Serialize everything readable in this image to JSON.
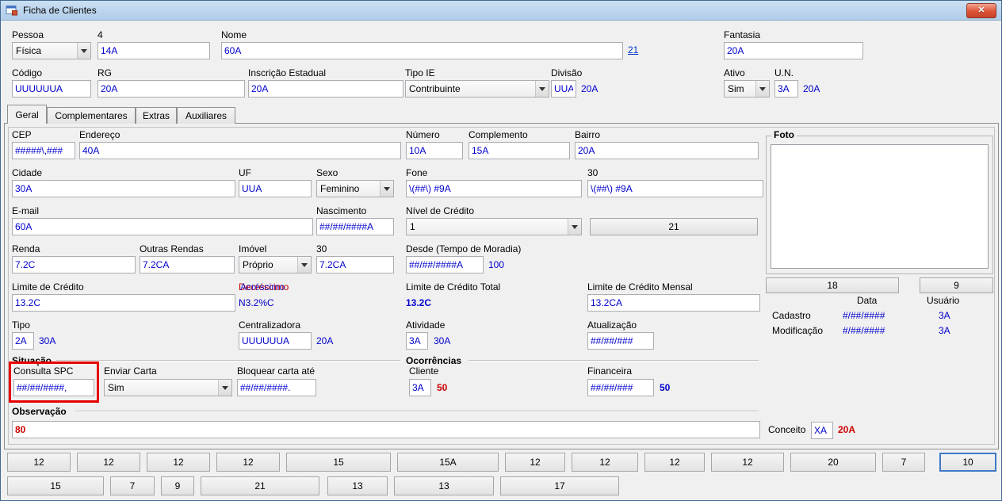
{
  "window": {
    "title": "Ficha de Clientes"
  },
  "header": {
    "pessoa": {
      "label": "Pessoa",
      "value": "Física"
    },
    "seq": {
      "label": "4",
      "value": "14A"
    },
    "nome": {
      "label": "Nome",
      "value": "60A",
      "link": "21"
    },
    "fantasia": {
      "label": "Fantasia",
      "value": "20A"
    },
    "codigo": {
      "label": "Código",
      "value": "UUUUUUA"
    },
    "rg": {
      "label": "RG",
      "value": "20A"
    },
    "inscricao_estadual": {
      "label": "Inscrição Estadual",
      "value": "20A"
    },
    "tipo_ie": {
      "label": "Tipo IE",
      "value": "Contribuinte"
    },
    "divisao": {
      "label": "Divisão",
      "value": "UUA",
      "extra": "20A"
    },
    "ativo": {
      "label": "Ativo",
      "value": "Sim"
    },
    "un": {
      "label": "U.N.",
      "value": "3A",
      "extra": "20A"
    }
  },
  "tabs": {
    "geral": "Geral",
    "complementares": "Complementares",
    "extras": "Extras",
    "auxiliares": "Auxiliares"
  },
  "geral": {
    "cep": {
      "label": "CEP",
      "value": "#####\\,###"
    },
    "endereco": {
      "label": "Endereço",
      "value": "40A"
    },
    "numero": {
      "label": "Número",
      "value": "10A"
    },
    "complemento": {
      "label": "Complemento",
      "value": "15A"
    },
    "bairro": {
      "label": "Bairro",
      "value": "20A"
    },
    "cidade": {
      "label": "Cidade",
      "value": "30A"
    },
    "uf": {
      "label": "UF",
      "value": "UUA"
    },
    "sexo": {
      "label": "Sexo",
      "value": "Feminino"
    },
    "fone": {
      "label": "Fone",
      "value": "\\(##\\) #9A"
    },
    "fone2": {
      "label": "30",
      "value": "\\(##\\) #9A"
    },
    "email": {
      "label": "E-mail",
      "value": "60A"
    },
    "nascimento": {
      "label": "Nascimento",
      "value": "##/##/####A"
    },
    "nivel_credito": {
      "label": "Nível de Crédito",
      "value": "1",
      "button": "21"
    },
    "renda": {
      "label": "Renda",
      "value": "7.2C"
    },
    "outras_rendas": {
      "label": "Outras Rendas",
      "value": "7.2CA"
    },
    "imovel": {
      "label": "Imóvel",
      "value": "Próprio"
    },
    "imovel_valor": {
      "label": "30",
      "value": "7.2CA"
    },
    "desde": {
      "label": "Desde (Tempo de Moradia)",
      "value": "##/##/####A",
      "extra": "100"
    },
    "limite_credito": {
      "label": "Limite de Crédito",
      "value": "13.2C"
    },
    "acrescimo": {
      "label_blue": "Acréscimo",
      "label_red": "Decréscimo",
      "value": "N3.2%C"
    },
    "limite_total": {
      "label": "Limite de Crédito Total",
      "value": "13.2C"
    },
    "limite_mensal": {
      "label": "Limite de Crédito Mensal",
      "value": "13.2CA"
    },
    "tipo": {
      "label": "Tipo",
      "value": "2A",
      "extra": "30A"
    },
    "centralizadora": {
      "label": "Centralizadora",
      "value": "UUUUUUA",
      "extra": "20A"
    },
    "atividade": {
      "label": "Atividade",
      "value": "3A",
      "extra": "30A"
    },
    "atualizacao": {
      "label": "Atualização",
      "value": "##/##/###"
    }
  },
  "foto": {
    "title": "Foto",
    "button_18": "18",
    "button_9": "9",
    "col_data": "Data",
    "col_usuario": "Usuário",
    "cadastro": {
      "label": "Cadastro",
      "data": "#/##/####",
      "usuario": "3A"
    },
    "modificacao": {
      "label": "Modificação",
      "data": "#/##/####",
      "usuario": "3A"
    }
  },
  "situacao": {
    "title": "Situação",
    "consulta_spc": {
      "label": "Consulta SPC",
      "value": "##/##/####,"
    },
    "enviar_carta": {
      "label": "Enviar Carta",
      "value": "Sim"
    },
    "bloquear": {
      "label": "Bloquear carta até",
      "value": "##/##/####."
    }
  },
  "ocorrencias": {
    "title": "Ocorrências",
    "cliente": {
      "label": "Cliente",
      "value": "3A",
      "extra": "50"
    },
    "financeira": {
      "label": "Financeira",
      "value": "##/##/###",
      "extra": "50"
    }
  },
  "observacao": {
    "title": "Observação",
    "value": "80",
    "conceito": {
      "label": "Conceito",
      "value": "XA",
      "extra": "20A"
    }
  },
  "buttons": {
    "row1": [
      "12",
      "12",
      "12",
      "12",
      "15",
      "15A",
      "12",
      "12",
      "12",
      "12",
      "20",
      "7",
      "10"
    ],
    "row2": [
      "15",
      "7",
      "9",
      "21",
      "13",
      "13",
      "17"
    ]
  },
  "colors": {
    "field_text": "#0000cc",
    "highlight": "#e80000",
    "titlebar": "#bdd6ee"
  }
}
